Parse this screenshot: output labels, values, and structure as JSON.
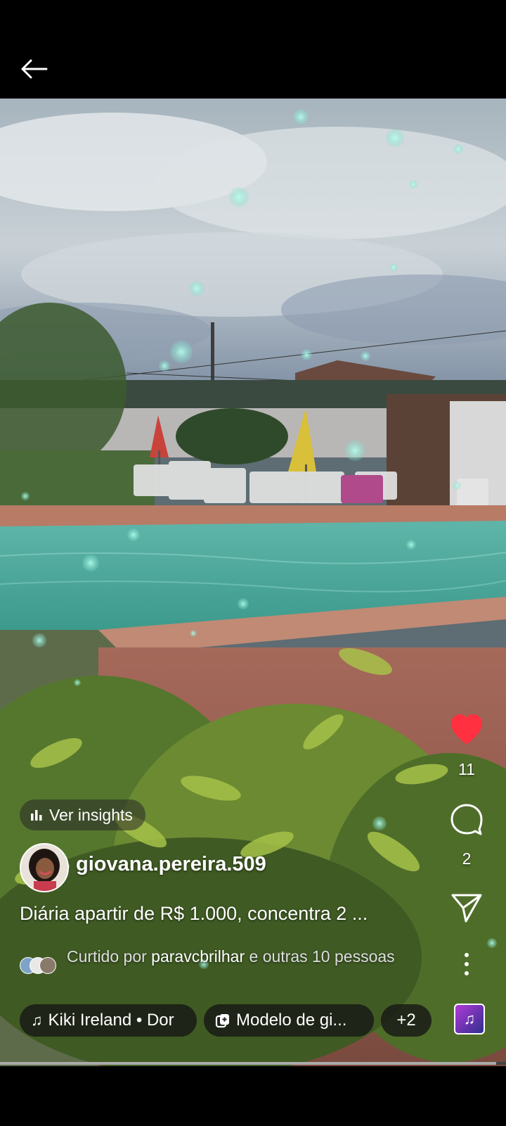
{
  "post": {
    "insights_label": "Ver insights",
    "username": "giovana.pereira.509",
    "caption": "Diária apartir de R$ 1.000, concentra 2 ...",
    "liked_prefix": "Curtido por ",
    "liked_user": "paravcbrilhar",
    "liked_suffix": " e outras 10 pessoas"
  },
  "actions": {
    "likes": "11",
    "comments": "2",
    "like_color": "#ff3040"
  },
  "chips": {
    "music": "Kiki Ireland • Dor",
    "template": "Modelo de gi...",
    "more": "+2"
  },
  "icons": [
    "back-arrow-icon",
    "chart-icon",
    "heart-icon",
    "comment-icon",
    "send-icon",
    "more-icon",
    "music-note-icon",
    "template-icon"
  ],
  "progress": 0.98
}
